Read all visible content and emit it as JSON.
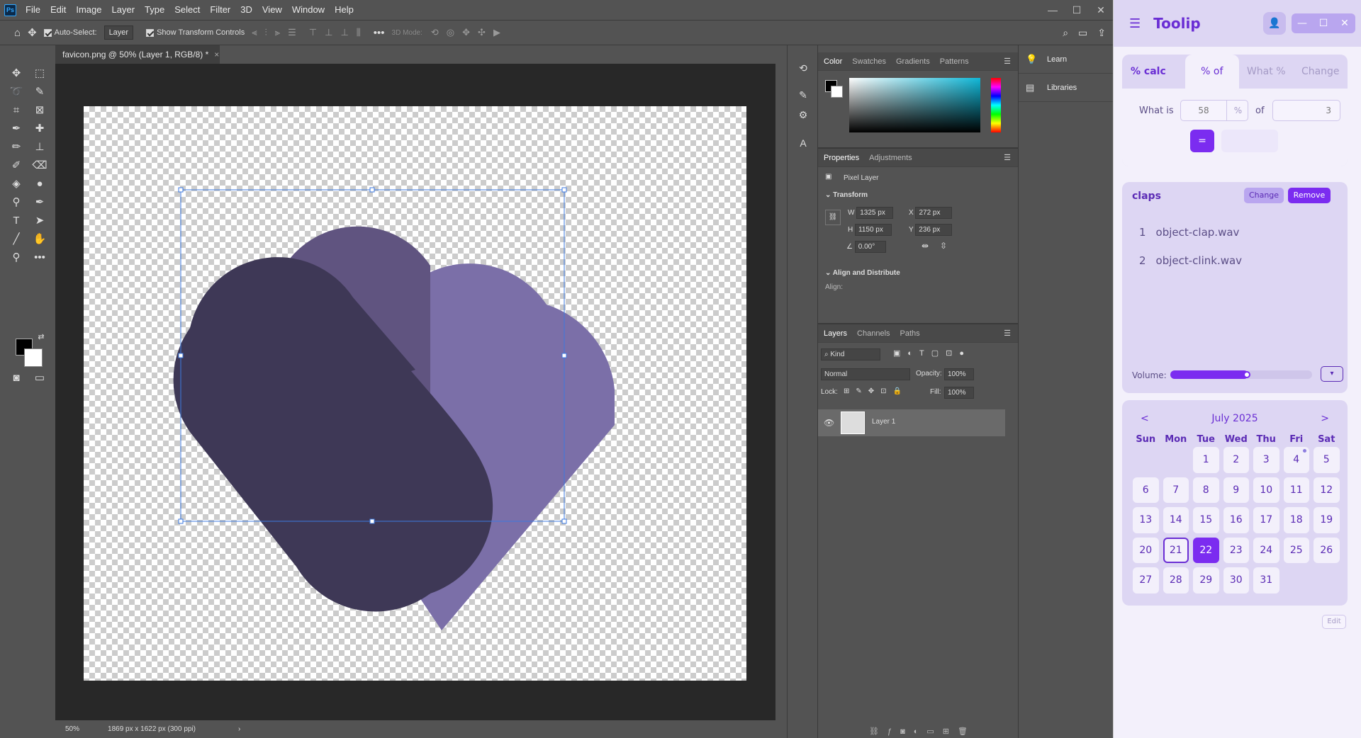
{
  "photoshop": {
    "logo": "Ps",
    "menu": [
      "File",
      "Edit",
      "Image",
      "Layer",
      "Type",
      "Select",
      "Filter",
      "3D",
      "View",
      "Window",
      "Help"
    ],
    "options": {
      "auto_select_label": "Auto-Select:",
      "auto_select_target": "Layer",
      "show_transform_label": "Show Transform Controls",
      "mode_3d": "3D Mode:"
    },
    "document_tab": "favicon.png @ 50% (Layer 1, RGB/8) *",
    "status": {
      "zoom": "50%",
      "doc_info": "1869 px x 1622 px (300 ppi)",
      "arrow": "›"
    },
    "color_panel": {
      "tabs": [
        "Color",
        "Swatches",
        "Gradients",
        "Patterns"
      ]
    },
    "properties_panel": {
      "tabs": [
        "Properties",
        "Adjustments"
      ],
      "layer_type": "Pixel Layer",
      "transform_title": "Transform",
      "w_label": "W",
      "w": "1325 px",
      "h_label": "H",
      "h": "1150 px",
      "x_label": "X",
      "x": "272 px",
      "y_label": "Y",
      "y": "236 px",
      "angle": "0.00°",
      "align_title": "Align and Distribute",
      "align_label": "Align:"
    },
    "layers_panel": {
      "tabs": [
        "Layers",
        "Channels",
        "Paths"
      ],
      "kind": "Kind",
      "blend_mode": "Normal",
      "opacity_label": "Opacity:",
      "opacity": "100%",
      "lock_label": "Lock:",
      "fill_label": "Fill:",
      "fill": "100%",
      "layer_name": "Layer 1"
    },
    "right_strip": [
      {
        "label": "Learn",
        "icon": "lightbulb-icon"
      },
      {
        "label": "Libraries",
        "icon": "libraries-icon"
      }
    ],
    "artwork_colors": {
      "light": "#7b6fa8",
      "mid": "#605480",
      "dark": "#3e3856"
    }
  },
  "toolip": {
    "title": "Toolip",
    "percent_calc": {
      "label": "% calc",
      "tabs": [
        "% of",
        "What %",
        "Change"
      ],
      "active_tab": "% of",
      "what_is_label": "What is",
      "value": "58",
      "percent_sign": "%",
      "of_label": "of",
      "base": "3",
      "equals_label": "=",
      "result": ""
    },
    "claps": {
      "title": "claps",
      "change_label": "Change",
      "remove_label": "Remove",
      "items": [
        {
          "n": "1",
          "file": "object-clap.wav"
        },
        {
          "n": "2",
          "file": "object-clink.wav"
        }
      ],
      "volume_label": "Volume:",
      "volume": 0.55
    },
    "calendar": {
      "prev": "<",
      "next": ">",
      "month": "July 2025",
      "weekdays": [
        "Sun",
        "Mon",
        "Tue",
        "Wed",
        "Thu",
        "Fri",
        "Sat"
      ],
      "days": [
        "",
        "",
        "1",
        "2",
        "3",
        "4",
        "5",
        "6",
        "7",
        "8",
        "9",
        "10",
        "11",
        "12",
        "13",
        "14",
        "15",
        "16",
        "17",
        "18",
        "19",
        "20",
        "21",
        "22",
        "23",
        "24",
        "25",
        "26",
        "27",
        "28",
        "29",
        "30",
        "31",
        "",
        ""
      ],
      "today": "21",
      "selected": "22",
      "marked": "4"
    },
    "edit_label": "Edit",
    "accent": "#7b2cf0"
  }
}
